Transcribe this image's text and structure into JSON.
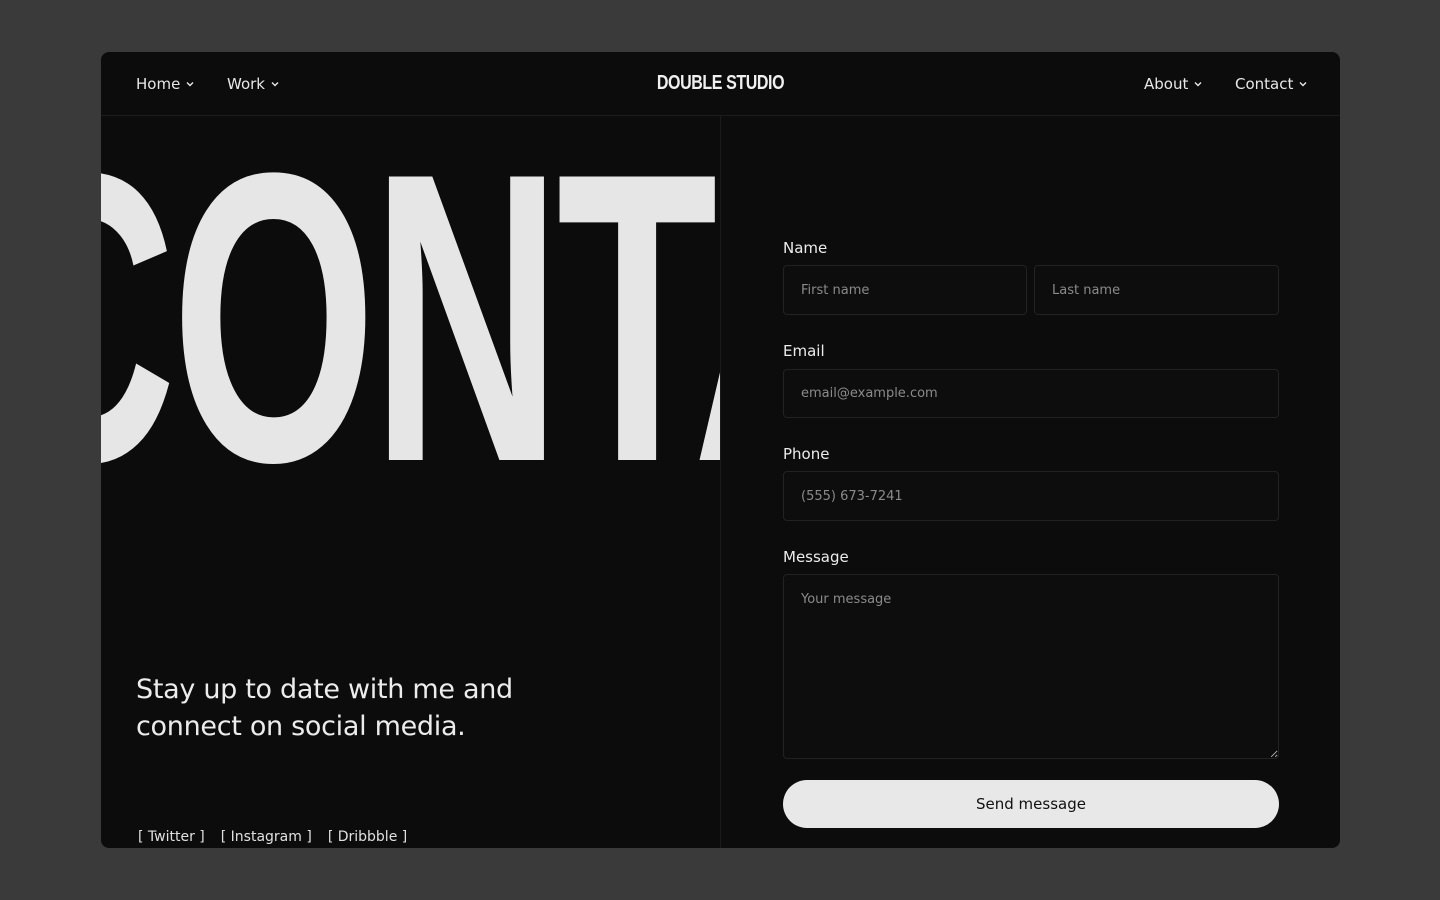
{
  "nav": {
    "brand": "DOUBLE STUDIO",
    "left": [
      {
        "label": "Home"
      },
      {
        "label": "Work"
      }
    ],
    "right": [
      {
        "label": "About"
      },
      {
        "label": "Contact"
      }
    ]
  },
  "hero": {
    "big_word": "CONTACT"
  },
  "left": {
    "tagline_line1": "Stay up to date with me and",
    "tagline_line2": "connect on social media.",
    "socials": [
      "[ Twitter ]",
      "[ Instagram ]",
      "[ Dribbble ]"
    ]
  },
  "form": {
    "name_label": "Name",
    "first_name_placeholder": "First name",
    "last_name_placeholder": "Last name",
    "email_label": "Email",
    "email_placeholder": "email@example.com",
    "phone_label": "Phone",
    "phone_placeholder": "(555) 673-7241",
    "message_label": "Message",
    "message_placeholder": "Your message",
    "submit_label": "Send message"
  },
  "colors": {
    "page_bg": "#3a3a3a",
    "panel_bg": "#0c0c0c",
    "text": "#e6e6e6",
    "button_bg": "#e8e8e8"
  }
}
